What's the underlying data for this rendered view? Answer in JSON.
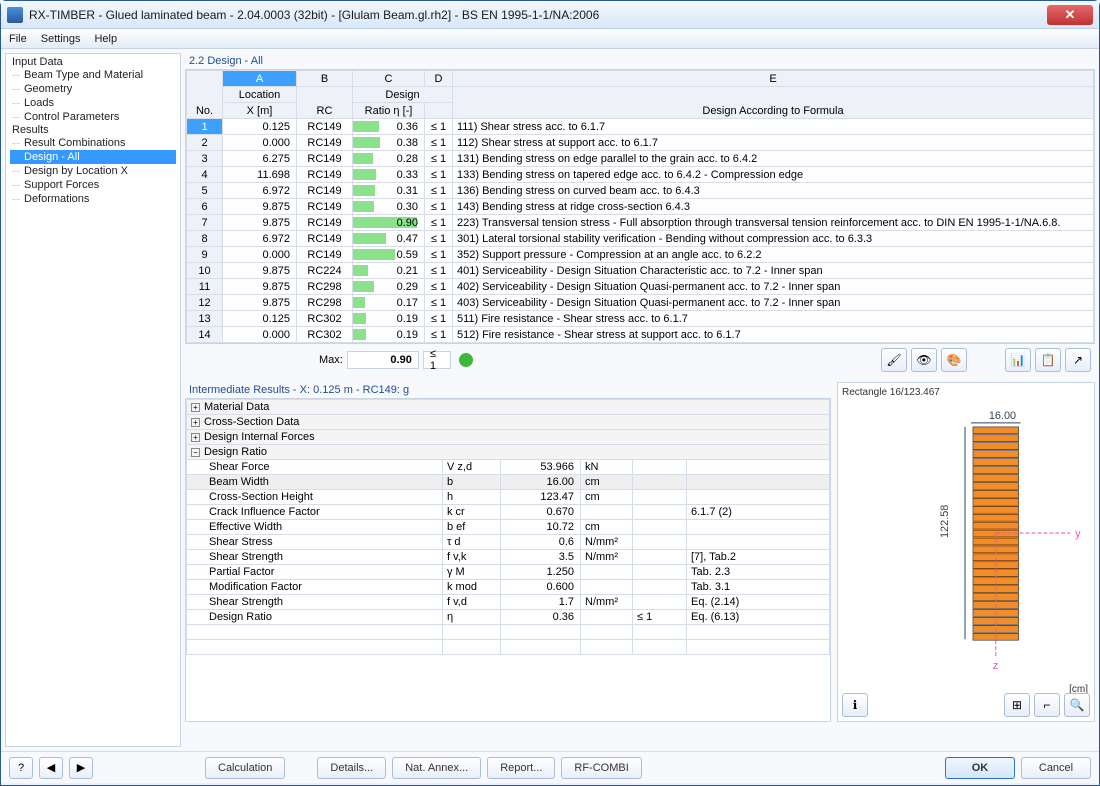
{
  "window": {
    "title": "RX-TIMBER - Glued laminated beam - 2.04.0003 (32bit) - [Glulam Beam.gl.rh2] - BS EN 1995-1-1/NA:2006"
  },
  "menu": [
    "File",
    "Settings",
    "Help"
  ],
  "tree": {
    "input": "Input Data",
    "beam": "Beam Type and Material",
    "geom": "Geometry",
    "loads": "Loads",
    "ctrl": "Control Parameters",
    "results": "Results",
    "rc": "Result Combinations",
    "da": "Design - All",
    "dlx": "Design by Location X",
    "sf": "Support Forces",
    "def": "Deformations"
  },
  "section_title": "2.2 Design - All",
  "table_headers": {
    "no": "No.",
    "a": "A",
    "b": "B",
    "c": "C",
    "d": "D",
    "e": "E",
    "loc": "Location",
    "des": "Design",
    "x": "X [m]",
    "rc": "RC",
    "ratio": "Ratio η [-]",
    "blank": "",
    "formula": "Design According to Formula"
  },
  "rows": [
    {
      "n": "1",
      "x": "0.125",
      "rc": "RC149",
      "r": "0.36",
      "lim": "≤ 1",
      "desc": "111) Shear stress acc. to 6.1.7",
      "bar": 36
    },
    {
      "n": "2",
      "x": "0.000",
      "rc": "RC149",
      "r": "0.38",
      "lim": "≤ 1",
      "desc": "112) Shear stress at support acc. to 6.1.7",
      "bar": 38
    },
    {
      "n": "3",
      "x": "6.275",
      "rc": "RC149",
      "r": "0.28",
      "lim": "≤ 1",
      "desc": "131) Bending stress on edge parallel to the grain acc. to 6.4.2",
      "bar": 28
    },
    {
      "n": "4",
      "x": "11.698",
      "rc": "RC149",
      "r": "0.33",
      "lim": "≤ 1",
      "desc": "133) Bending stress on tapered edge acc. to 6.4.2 - Compression edge",
      "bar": 33
    },
    {
      "n": "5",
      "x": "6.972",
      "rc": "RC149",
      "r": "0.31",
      "lim": "≤ 1",
      "desc": "136) Bending stress on curved beam acc. to 6.4.3",
      "bar": 31
    },
    {
      "n": "6",
      "x": "9.875",
      "rc": "RC149",
      "r": "0.30",
      "lim": "≤ 1",
      "desc": "143) Bending stress at ridge cross-section 6.4.3",
      "bar": 30
    },
    {
      "n": "7",
      "x": "9.875",
      "rc": "RC149",
      "r": "0.90",
      "lim": "≤ 1",
      "desc": "223) Transversal tension stress - Full absorption through transversal tension reinforcement acc. to DIN EN 1995-1-1/NA.6.8.",
      "bar": 90
    },
    {
      "n": "8",
      "x": "6.972",
      "rc": "RC149",
      "r": "0.47",
      "lim": "≤ 1",
      "desc": "301) Lateral torsional stability verification - Bending without compression acc. to 6.3.3",
      "bar": 47
    },
    {
      "n": "9",
      "x": "0.000",
      "rc": "RC149",
      "r": "0.59",
      "lim": "≤ 1",
      "desc": "352) Support pressure - Compression at an angle acc. to 6.2.2",
      "bar": 59
    },
    {
      "n": "10",
      "x": "9.875",
      "rc": "RC224",
      "r": "0.21",
      "lim": "≤ 1",
      "desc": "401) Serviceability - Design Situation Characteristic acc. to 7.2 - Inner span",
      "bar": 21
    },
    {
      "n": "11",
      "x": "9.875",
      "rc": "RC298",
      "r": "0.29",
      "lim": "≤ 1",
      "desc": "402) Serviceability - Design Situation Quasi-permanent acc. to 7.2 - Inner span",
      "bar": 29
    },
    {
      "n": "12",
      "x": "9.875",
      "rc": "RC298",
      "r": "0.17",
      "lim": "≤ 1",
      "desc": "403) Serviceability - Design Situation Quasi-permanent acc. to 7.2 - Inner span",
      "bar": 17
    },
    {
      "n": "13",
      "x": "0.125",
      "rc": "RC302",
      "r": "0.19",
      "lim": "≤ 1",
      "desc": "511) Fire resistance - Shear stress acc. to 6.1.7",
      "bar": 19
    },
    {
      "n": "14",
      "x": "0.000",
      "rc": "RC302",
      "r": "0.19",
      "lim": "≤ 1",
      "desc": "512) Fire resistance - Shear stress at support acc. to 6.1.7",
      "bar": 19
    }
  ],
  "max": {
    "label": "Max:",
    "val": "0.90",
    "lim": "≤ 1"
  },
  "intermediate_title": "Intermediate Results  -  X: 0.125 m  -  RC149: g",
  "groups": {
    "mat": "Material Data",
    "cs": "Cross-Section Data",
    "dif": "Design Internal Forces",
    "dr": "Design Ratio"
  },
  "details": [
    {
      "k": "Shear Force",
      "sym": "V z,d",
      "val": "53.966",
      "u": "kN",
      "e": ""
    },
    {
      "k": "Beam Width",
      "sym": "b",
      "val": "16.00",
      "u": "cm",
      "e": "",
      "hl": true
    },
    {
      "k": "Cross-Section Height",
      "sym": "h",
      "val": "123.47",
      "u": "cm",
      "e": ""
    },
    {
      "k": "Crack Influence Factor",
      "sym": "k cr",
      "val": "0.670",
      "u": "",
      "e": "6.1.7 (2)"
    },
    {
      "k": "Effective Width",
      "sym": "b ef",
      "val": "10.72",
      "u": "cm",
      "e": ""
    },
    {
      "k": "Shear Stress",
      "sym": "τ d",
      "val": "0.6",
      "u": "N/mm²",
      "e": ""
    },
    {
      "k": "Shear Strength",
      "sym": "f v,k",
      "val": "3.5",
      "u": "N/mm²",
      "e": "[7], Tab.2"
    },
    {
      "k": "Partial Factor",
      "sym": "γ M",
      "val": "1.250",
      "u": "",
      "e": "Tab. 2.3"
    },
    {
      "k": "Modification Factor",
      "sym": "k mod",
      "val": "0.600",
      "u": "",
      "e": "Tab. 3.1"
    },
    {
      "k": "Shear Strength",
      "sym": "f v,d",
      "val": "1.7",
      "u": "N/mm²",
      "e": "Eq. (2.14)"
    },
    {
      "k": "Design Ratio",
      "sym": "η",
      "val": "0.36",
      "u": "",
      "lim": "≤ 1",
      "e": "Eq. (6.13)"
    }
  ],
  "cross_section": {
    "title": "Rectangle 16/123.467",
    "w": "16.00",
    "h": "122.58",
    "unit": "[cm]"
  },
  "footer": {
    "calc": "Calculation",
    "det": "Details...",
    "na": "Nat. Annex...",
    "rep": "Report...",
    "rf": "RF-COMBI",
    "ok": "OK",
    "cancel": "Cancel"
  }
}
